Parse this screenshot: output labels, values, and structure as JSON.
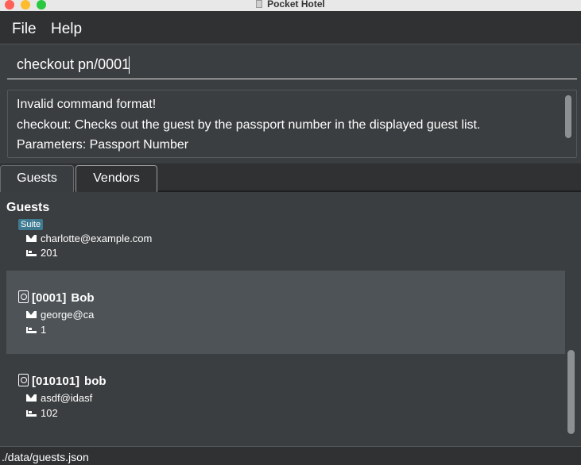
{
  "window": {
    "title": "Pocket Hotel"
  },
  "menu": {
    "file": "File",
    "help": "Help"
  },
  "command": {
    "value": "checkout pn/0001"
  },
  "result": {
    "lines": [
      "Invalid command format!",
      "checkout: Checks out the guest by the passport number in the displayed guest list.",
      "Parameters: Passport Number"
    ]
  },
  "tabs": [
    {
      "label": "Guests"
    },
    {
      "label": "Vendors"
    }
  ],
  "list": {
    "header": "Guests",
    "guests": [
      {
        "passport": "",
        "name": "",
        "room_type": "Suite",
        "email": "charlotte@example.com",
        "room": "201"
      },
      {
        "passport": "[0001]",
        "name": "Bob",
        "email": "george@ca",
        "room": "1"
      },
      {
        "passport": "[010101]",
        "name": "bob",
        "email": "asdf@idasf",
        "room": "102"
      }
    ]
  },
  "status": {
    "path": "./data/guests.json"
  },
  "colors": {
    "background": "#3b3e40",
    "selected_card": "#4d5356",
    "badge": "#3e7b91"
  },
  "icons": {
    "passport": "passport-icon",
    "email": "mail-icon",
    "room": "bed-icon"
  }
}
